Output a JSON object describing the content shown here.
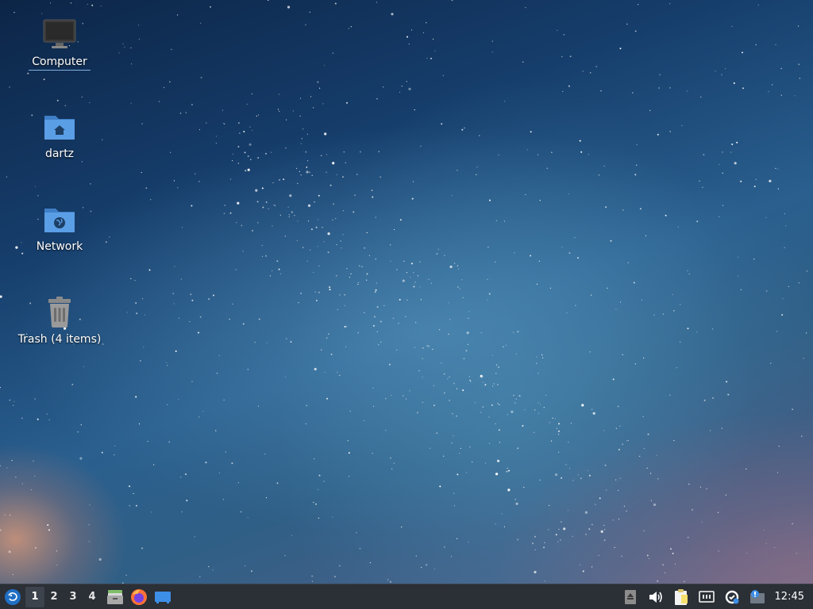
{
  "desktop": {
    "icons": [
      {
        "label": "Computer",
        "icon": "monitor-icon"
      },
      {
        "label": "dartz",
        "icon": "home-folder-icon"
      },
      {
        "label": "Network",
        "icon": "network-folder-icon"
      },
      {
        "label": "Trash (4 items)",
        "icon": "trash-icon"
      }
    ]
  },
  "taskbar": {
    "start_icon": "whisker-menu-icon",
    "workspaces": [
      "1",
      "2",
      "3",
      "4"
    ],
    "active_workspace": "1",
    "launchers": [
      {
        "name": "file-manager",
        "icon": "file-manager-icon"
      },
      {
        "name": "firefox",
        "icon": "firefox-icon"
      },
      {
        "name": "show-desktop",
        "icon": "desktop-icon"
      }
    ],
    "tray": [
      {
        "name": "eject",
        "icon": "eject-icon"
      },
      {
        "name": "volume",
        "icon": "speaker-icon"
      },
      {
        "name": "clipboard",
        "icon": "clipboard-icon"
      },
      {
        "name": "network",
        "icon": "network-wired-icon"
      },
      {
        "name": "updates",
        "icon": "update-icon"
      },
      {
        "name": "notifications",
        "icon": "notification-icon"
      }
    ],
    "clock": "12:45"
  },
  "colors": {
    "taskbar_bg": "#2b2f36",
    "folder_blue": "#5a9ee6",
    "text": "#ffffff"
  }
}
